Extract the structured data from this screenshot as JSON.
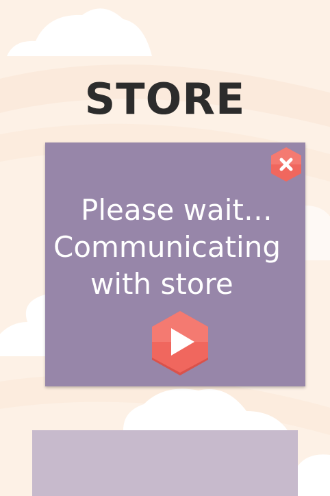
{
  "store": {
    "title": "STORE"
  },
  "dialog": {
    "line1": "Please wait…",
    "line2": "Communicating",
    "line3": "with store"
  },
  "colors": {
    "background": "#fdf1e6",
    "dialog": "#9786a9",
    "accent": "#f0675e",
    "panel": "#c7bacc"
  },
  "icons": {
    "close": "close-icon",
    "play": "play-icon"
  }
}
